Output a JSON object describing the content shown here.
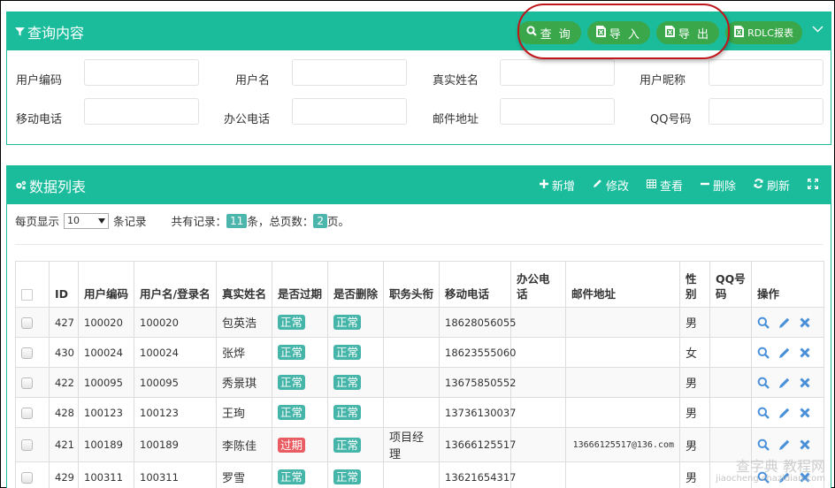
{
  "query_panel": {
    "title": "查询内容",
    "icon": "filter-icon",
    "buttons": [
      {
        "label": "查 询",
        "icon": "search-icon"
      },
      {
        "label": "导 入",
        "icon": "excel-icon"
      },
      {
        "label": "导 出",
        "icon": "excel-icon"
      },
      {
        "label": "RDLC报表",
        "icon": "excel-icon"
      }
    ],
    "collapse_icon": "chevron-down-icon",
    "fields": [
      {
        "label": "用户编码",
        "value": "",
        "placeholder": ""
      },
      {
        "label": "用户名",
        "value": "",
        "placeholder": ""
      },
      {
        "label": "真实姓名",
        "value": "",
        "placeholder": ""
      },
      {
        "label": "用户昵称",
        "value": "",
        "placeholder": ""
      },
      {
        "label": "移动电话",
        "value": "",
        "placeholder": ""
      },
      {
        "label": "办公电话",
        "value": "",
        "placeholder": ""
      },
      {
        "label": "邮件地址",
        "value": "",
        "placeholder": ""
      },
      {
        "label": "QQ号码",
        "value": "",
        "placeholder": ""
      }
    ]
  },
  "list_panel": {
    "title": "数据列表",
    "icon": "gears-icon",
    "toolbar": [
      {
        "label": "新增",
        "icon": "plus-icon"
      },
      {
        "label": "修改",
        "icon": "pencil-icon"
      },
      {
        "label": "查看",
        "icon": "table-icon"
      },
      {
        "label": "删除",
        "icon": "minus-icon"
      },
      {
        "label": "刷新",
        "icon": "refresh-icon"
      },
      {
        "label": "",
        "icon": "fullscreen-icon"
      }
    ],
    "paging": {
      "per_page_prefix": "每页显示",
      "per_page_value": "10",
      "per_page_suffix": "条记录",
      "total_prefix": "共有记录：",
      "total_records": "11",
      "total_mid": "条，总页数：",
      "total_pages": "2",
      "total_suffix": "页。"
    },
    "columns": [
      "",
      "ID",
      "用户编码",
      "用户名/登录名",
      "真实姓名",
      "是否过期",
      "是否删除",
      "职务头衔",
      "移动电话",
      "办公电话",
      "邮件地址",
      "性别",
      "QQ号码",
      "操作"
    ],
    "rows": [
      {
        "id": "427",
        "code": "100020",
        "login": "100020",
        "name": "包英浩",
        "expired": "正常",
        "expired_status": "ok",
        "deleted": "正常",
        "title": "",
        "mobile": "18628056055",
        "office": "",
        "email": "",
        "gender": "男",
        "qq": ""
      },
      {
        "id": "430",
        "code": "100024",
        "login": "100024",
        "name": "张烨",
        "expired": "正常",
        "expired_status": "ok",
        "deleted": "正常",
        "title": "",
        "mobile": "18623555060",
        "office": "",
        "email": "",
        "gender": "女",
        "qq": ""
      },
      {
        "id": "422",
        "code": "100095",
        "login": "100095",
        "name": "秀景琪",
        "expired": "正常",
        "expired_status": "ok",
        "deleted": "正常",
        "title": "",
        "mobile": "13675850552",
        "office": "",
        "email": "",
        "gender": "男",
        "qq": ""
      },
      {
        "id": "428",
        "code": "100123",
        "login": "100123",
        "name": "王珣",
        "expired": "正常",
        "expired_status": "ok",
        "deleted": "正常",
        "title": "",
        "mobile": "13736130037",
        "office": "",
        "email": "",
        "gender": "男",
        "qq": ""
      },
      {
        "id": "421",
        "code": "100189",
        "login": "100189",
        "name": "李陈佳",
        "expired": "过期",
        "expired_status": "bad",
        "deleted": "正常",
        "title": "项目经理",
        "mobile": "13666125517",
        "office": "",
        "email": "13666125517@136.com",
        "gender": "男",
        "qq": ""
      },
      {
        "id": "429",
        "code": "100311",
        "login": "100311",
        "name": "罗雪",
        "expired": "正常",
        "expired_status": "ok",
        "deleted": "正常",
        "title": "",
        "mobile": "13621654317",
        "office": "",
        "email": "",
        "gender": "男",
        "qq": ""
      }
    ],
    "row_actions": [
      {
        "icon": "search-icon"
      },
      {
        "icon": "pencil-icon"
      },
      {
        "icon": "close-icon"
      }
    ]
  },
  "watermark": {
    "line1": "查字典 教程网",
    "line2": "jiaocheng.chazidian.com"
  },
  "colors": {
    "header_green": "#1abc9c",
    "button_green": "#3aa74a",
    "label_ok": "#45b5aa",
    "label_bad": "#e85c62",
    "action_blue": "#4a90d9",
    "highlight_red": "#c0151b"
  }
}
